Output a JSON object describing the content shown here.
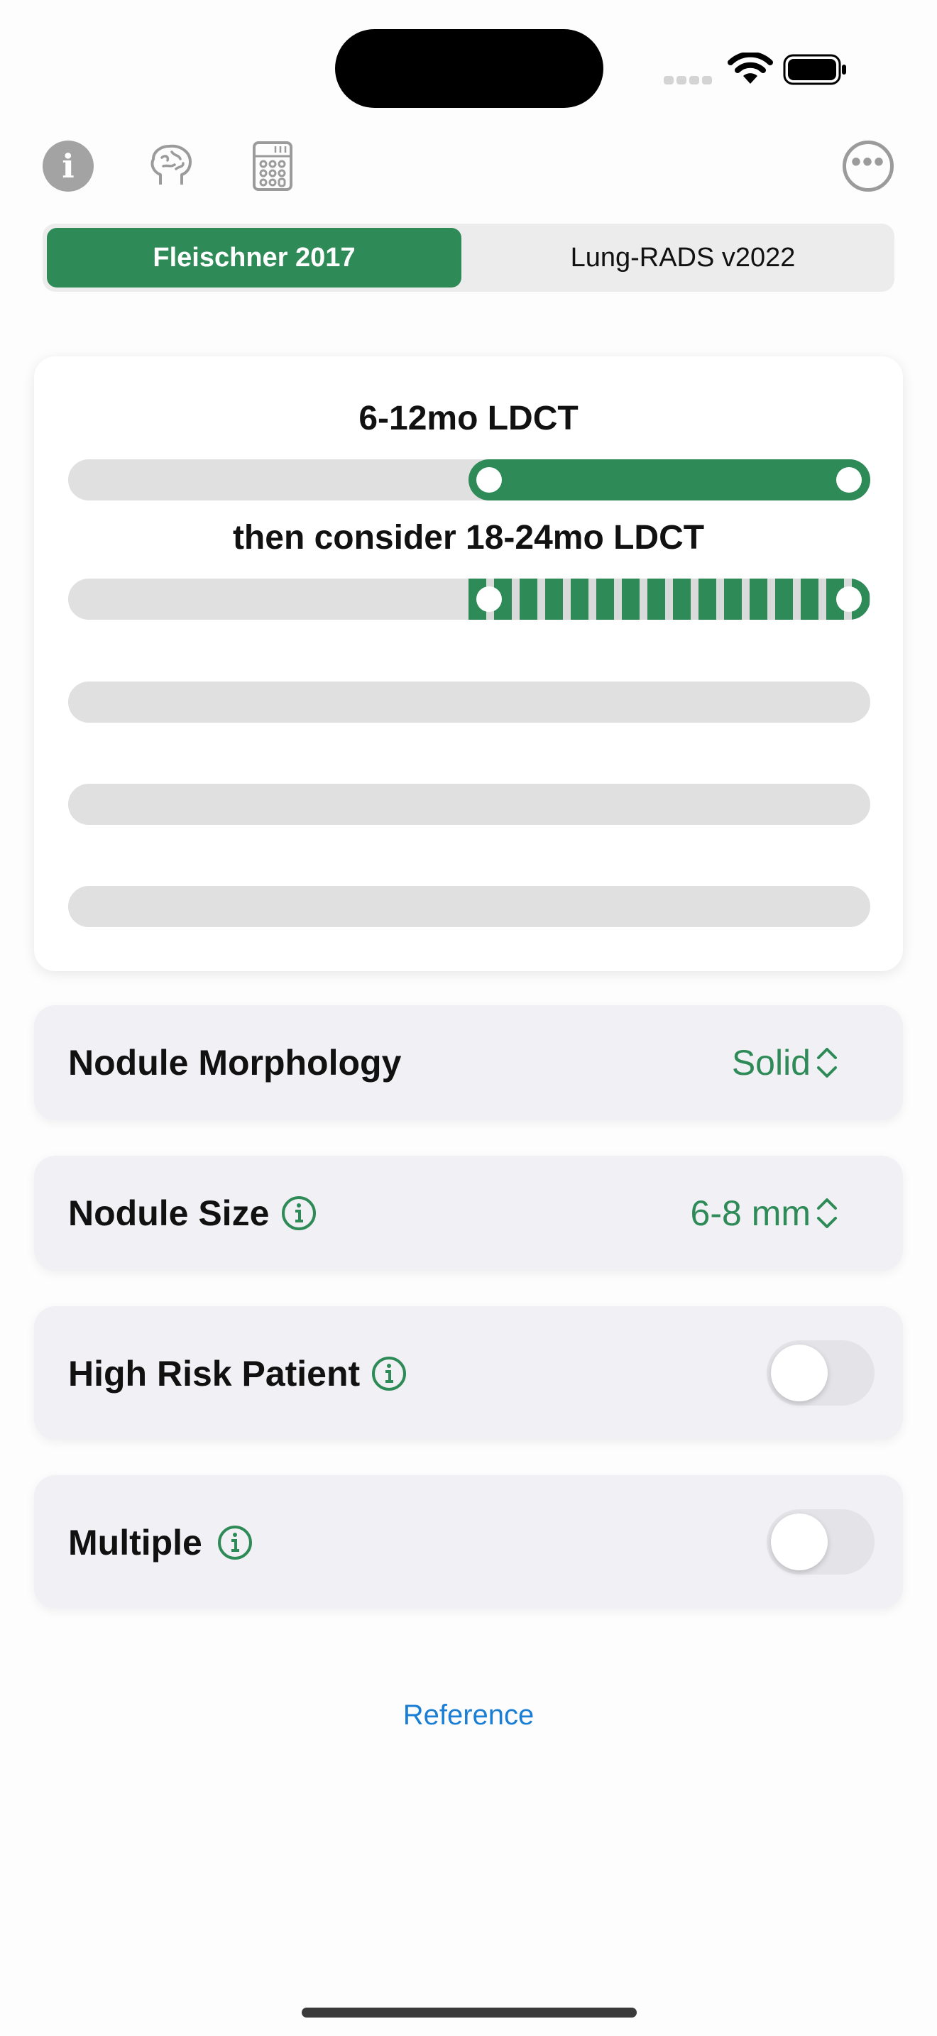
{
  "toolbar": {
    "info_glyph": "i",
    "more_glyph": "•••"
  },
  "segments": {
    "active": "Fleischner 2017",
    "inactive": "Lung-RADS v2022"
  },
  "recommendation": {
    "primary": "6-12mo LDCT",
    "secondary": "then consider 18-24mo LDCT"
  },
  "settings": {
    "morphology": {
      "label": "Nodule Morphology",
      "value": "Solid"
    },
    "size": {
      "label": "Nodule Size",
      "value": "6-8 mm"
    },
    "high_risk": {
      "label": "High Risk Patient",
      "on": false
    },
    "multiple": {
      "label": "Multiple",
      "on": false
    }
  },
  "footer": {
    "reference_link": "Reference"
  },
  "colors": {
    "accent": "#2e8b57",
    "link": "#1a7fd4",
    "track": "#e0e0e0"
  }
}
